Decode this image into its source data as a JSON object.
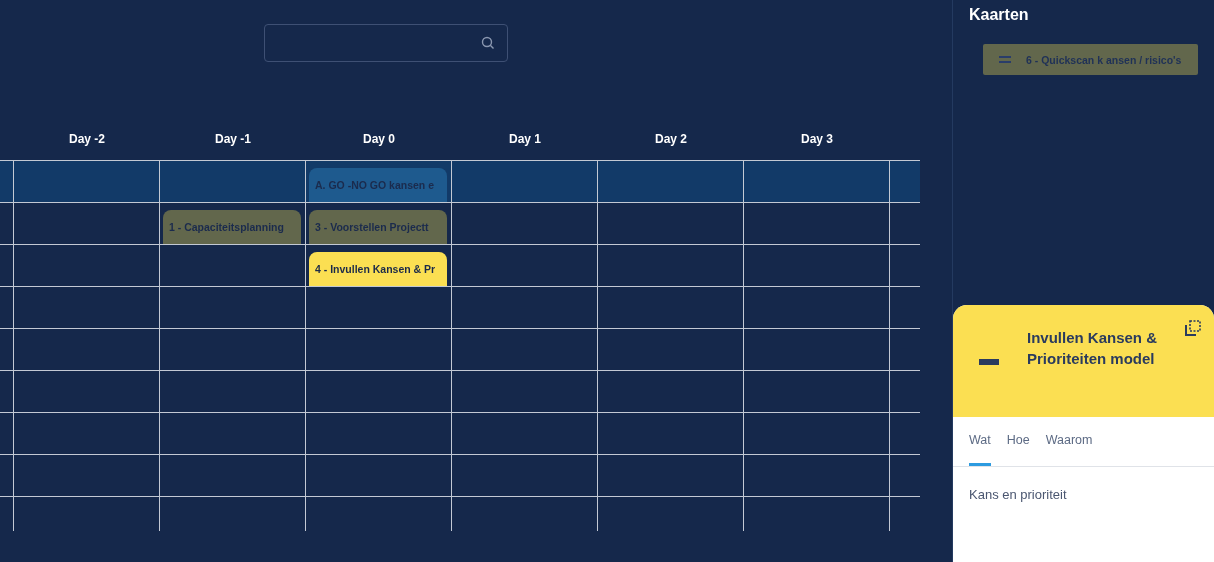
{
  "calendar": {
    "columns": [
      "",
      "Day -2",
      "Day -1",
      "Day 0",
      "Day 1",
      "Day 2",
      "Day 3",
      ""
    ],
    "rows": [
      {
        "selected": true,
        "cells": [
          null,
          null,
          null,
          {
            "label": "A. GO -NO GO kansen e",
            "color": "#1e5a8e"
          },
          null,
          null,
          null,
          null
        ]
      },
      {
        "selected": false,
        "cells": [
          null,
          null,
          {
            "label": "1 - Capaciteitsplanning",
            "color": "#62674c"
          },
          {
            "label": "3 - Voorstellen Projectt",
            "color": "#62674c"
          },
          null,
          null,
          null,
          null
        ]
      },
      {
        "selected": false,
        "cells": [
          null,
          null,
          null,
          {
            "label": "4 - Invullen Kansen & Pr",
            "color": "#fbdf52"
          },
          null,
          null,
          null,
          null
        ]
      },
      {
        "selected": false,
        "cells": [
          null,
          null,
          null,
          null,
          null,
          null,
          null,
          null
        ]
      },
      {
        "selected": false,
        "cells": [
          null,
          null,
          null,
          null,
          null,
          null,
          null,
          null
        ]
      },
      {
        "selected": false,
        "cells": [
          null,
          null,
          null,
          null,
          null,
          null,
          null,
          null
        ]
      },
      {
        "selected": false,
        "cells": [
          null,
          null,
          null,
          null,
          null,
          null,
          null,
          null
        ]
      },
      {
        "selected": false,
        "cells": [
          null,
          null,
          null,
          null,
          null,
          null,
          null,
          null
        ]
      },
      {
        "selected": false,
        "cells": [
          null,
          null,
          null,
          null,
          null,
          null,
          null,
          null
        ]
      }
    ]
  },
  "sidebar": {
    "title": "Kaarten",
    "cards": [
      {
        "label": "6 - Quickscan k ansen / risico's",
        "color": "#62674c"
      }
    ]
  },
  "detail": {
    "title": "Invullen Kansen & Prioriteiten model",
    "tabs": [
      {
        "label": "Wat",
        "selected": true
      },
      {
        "label": "Hoe",
        "selected": false
      },
      {
        "label": "Waarom",
        "selected": false
      }
    ],
    "content": "Kans en prioriteit"
  }
}
